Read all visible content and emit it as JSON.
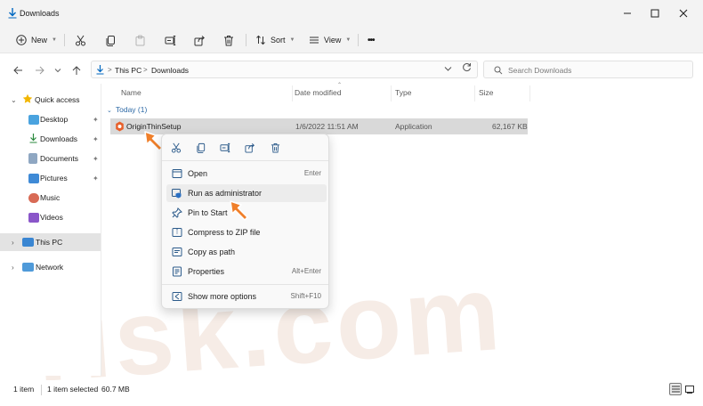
{
  "window": {
    "title": "Downloads"
  },
  "toolbar": {
    "new_label": "New",
    "sort_label": "Sort",
    "view_label": "View",
    "more_label": "•••"
  },
  "address": {
    "crumbs": [
      "This PC",
      "Downloads"
    ],
    "separator": ">"
  },
  "search": {
    "placeholder": "Search Downloads"
  },
  "sidebar": {
    "items": [
      {
        "label": "Quick access"
      },
      {
        "label": "Desktop"
      },
      {
        "label": "Downloads"
      },
      {
        "label": "Documents"
      },
      {
        "label": "Pictures"
      },
      {
        "label": "Music"
      },
      {
        "label": "Videos"
      },
      {
        "label": "This PC"
      },
      {
        "label": "Network"
      }
    ]
  },
  "columns": {
    "name": "Name",
    "date": "Date modified",
    "type": "Type",
    "size": "Size"
  },
  "group": {
    "label": "Today (1)"
  },
  "file": {
    "name": "OriginThinSetup",
    "date": "1/6/2022 11:51 AM",
    "type": "Application",
    "size": "62,167 KB"
  },
  "context_menu": {
    "items": [
      {
        "label": "Open",
        "shortcut": "Enter"
      },
      {
        "label": "Run as administrator",
        "shortcut": ""
      },
      {
        "label": "Pin to Start",
        "shortcut": ""
      },
      {
        "label": "Compress to ZIP file",
        "shortcut": ""
      },
      {
        "label": "Copy as path",
        "shortcut": ""
      },
      {
        "label": "Properties",
        "shortcut": "Alt+Enter"
      },
      {
        "label": "Show more options",
        "shortcut": "Shift+F10"
      }
    ]
  },
  "status": {
    "item_count": "1 item",
    "selection": "1 item selected",
    "selection_size": "60.7 MB"
  },
  "watermark": {
    "text": "risk.com"
  },
  "colors": {
    "accent": "#0067c0",
    "pointer": "#f07f2a",
    "selection": "#d9d9d9",
    "chrome": "#f3f3f3"
  }
}
